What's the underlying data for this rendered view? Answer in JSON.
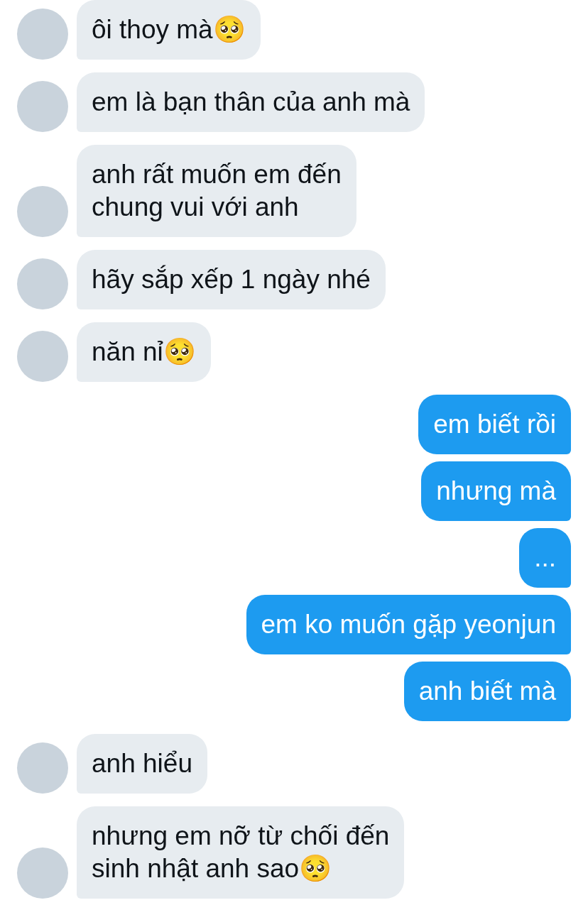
{
  "messages": [
    {
      "kind": "incoming",
      "lines": [
        "ôi thoy mà🥺"
      ]
    },
    {
      "kind": "incoming",
      "lines": [
        "em là bạn thân của anh mà"
      ]
    },
    {
      "kind": "incoming",
      "lines": [
        "anh rất muốn em đến",
        "chung vui với anh"
      ]
    },
    {
      "kind": "incoming",
      "lines": [
        "hãy sắp xếp 1 ngày nhé"
      ]
    },
    {
      "kind": "incoming",
      "lines": [
        "năn nỉ🥺"
      ]
    },
    {
      "kind": "outgoing",
      "lines": [
        "em biết rồi"
      ]
    },
    {
      "kind": "outgoing",
      "lines": [
        "nhưng mà"
      ]
    },
    {
      "kind": "outgoing",
      "lines": [
        "..."
      ]
    },
    {
      "kind": "outgoing",
      "lines": [
        "em ko muốn gặp yeonjun"
      ]
    },
    {
      "kind": "outgoing",
      "lines": [
        "anh biết mà"
      ]
    },
    {
      "kind": "incoming",
      "lines": [
        "anh hiểu"
      ]
    },
    {
      "kind": "incoming",
      "lines": [
        "nhưng em nỡ từ chối đến",
        "sinh nhật anh sao🥺"
      ]
    }
  ]
}
